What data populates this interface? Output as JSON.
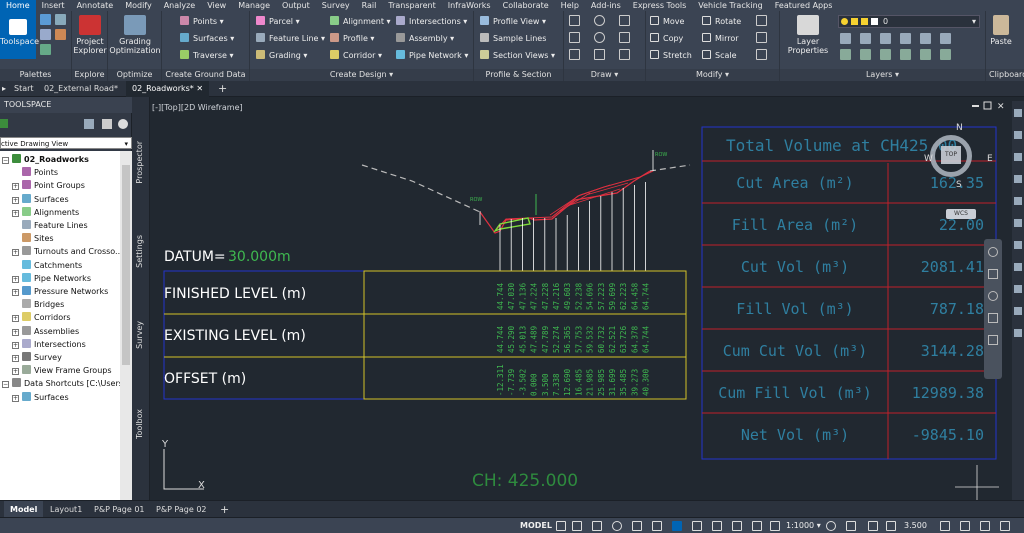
{
  "menu": [
    "Home",
    "Insert",
    "Annotate",
    "Modify",
    "Analyze",
    "View",
    "Manage",
    "Output",
    "Survey",
    "Rail",
    "Transparent",
    "InfraWorks",
    "Collaborate",
    "Help",
    "Add-ins",
    "Express Tools",
    "Vehicle Tracking",
    "Featured Apps"
  ],
  "ribbon": {
    "toolspace": "Toolspace",
    "project_explorer": [
      "Project",
      "Explorer"
    ],
    "grading_opt": [
      "Grading",
      "Optimization"
    ],
    "panels": [
      "Palettes",
      "Explore",
      "Optimize",
      "Create Ground Data",
      "Create Design",
      "Profile & Section Views",
      "Draw",
      "Modify",
      "Layers",
      "Clipboard"
    ],
    "ground": [
      "Points",
      "Surfaces",
      "Traverse"
    ],
    "design1": [
      "Parcel",
      "Feature Line",
      "Grading"
    ],
    "design2": [
      "Alignment",
      "Profile",
      "Corridor"
    ],
    "design3": [
      "Intersections",
      "Assembly",
      "Pipe Network"
    ],
    "psv": [
      "Profile View",
      "Sample Lines",
      "Section Views"
    ],
    "modify1": [
      "Move",
      "Copy",
      "Stretch"
    ],
    "modify2": [
      "Rotate",
      "Mirror",
      "Scale"
    ],
    "layer_props": [
      "Layer",
      "Properties"
    ],
    "layer_value": "0",
    "paste": "Paste"
  },
  "tabs": [
    "Start",
    "02_External Road*",
    "02_Roadworks*"
  ],
  "toolspace": {
    "title": "TOOLSPACE",
    "view": "ctive Drawing View",
    "items": [
      "02_Roadworks",
      "Points",
      "Point Groups",
      "Surfaces",
      "Alignments",
      "Feature Lines",
      "Sites",
      "Turnouts and Crosso...",
      "Catchments",
      "Pipe Networks",
      "Pressure Networks",
      "Bridges",
      "Corridors",
      "Assemblies",
      "Intersections",
      "Survey",
      "View Frame Groups",
      "Data Shortcuts [C:\\Users\\...",
      "Surfaces"
    ]
  },
  "side_tabs": [
    "Prospector",
    "Settings",
    "Survey",
    "Toolbox"
  ],
  "viewport_label": "[-][Top][2D Wireframe]",
  "section": {
    "datum_label": "DATUM=",
    "datum_value": "30.000m",
    "row_labels": [
      "FINISHED LEVEL (m)",
      "EXISTING LEVEL (m)",
      "OFFSET (m)"
    ],
    "finished": [
      "44.744",
      "47.030",
      "47.136",
      "47.224",
      "47.228",
      "47.216",
      "49.603",
      "52.238",
      "54.696",
      "57.223",
      "59.699",
      "62.223",
      "64.458",
      "64.744"
    ],
    "existing": [
      "44.744",
      "45.290",
      "45.013",
      "47.489",
      "47.789",
      "52.274",
      "56.365",
      "57.753",
      "59.532",
      "60.732",
      "62.521",
      "63.726",
      "64.378",
      "64.744"
    ],
    "offset": [
      "-12.311",
      "-7.739",
      "-3.502",
      "0.000",
      "3.500",
      "7.338",
      "12.690",
      "16.485",
      "21.985",
      "25.985",
      "31.699",
      "35.485",
      "39.273",
      "40.300"
    ],
    "ch_label": "CH: 425.000",
    "row_tags": [
      "ROW",
      "ROW"
    ]
  },
  "volume_table": {
    "title": "Total Volume at CH425.00",
    "rows": [
      {
        "label": "Cut Area (m²)",
        "value": "162.35"
      },
      {
        "label": "Fill Area (m²)",
        "value": "22.00"
      },
      {
        "label": "Cut Vol (m³)",
        "value": "2081.41"
      },
      {
        "label": "Fill Vol (m³)",
        "value": "787.18"
      },
      {
        "label": "Cum Cut Vol (m³)",
        "value": "3144.28"
      },
      {
        "label": "Cum Fill Vol (m³)",
        "value": "12989.38"
      },
      {
        "label": "Net Vol (m³)",
        "value": "-9845.10"
      }
    ]
  },
  "viewcube": {
    "n": "N",
    "s": "S",
    "e": "E",
    "w": "W",
    "top": "TOP",
    "wcs": "WCS"
  },
  "ucs": {
    "x": "X",
    "y": "Y"
  },
  "layout_tabs": [
    "Model",
    "Layout1",
    "P&P Page 01",
    "P&P Page 02"
  ],
  "status": {
    "model": "MODEL",
    "scale": "1:1000",
    "value": "3.500"
  },
  "colors": {
    "accent": "#0064b4",
    "cad_text": "#3fb950",
    "table_border_red": "#c0202a",
    "table_border_blue": "#2233cc",
    "band_yellow": "#d4c229",
    "cut_red": "#e03040"
  }
}
